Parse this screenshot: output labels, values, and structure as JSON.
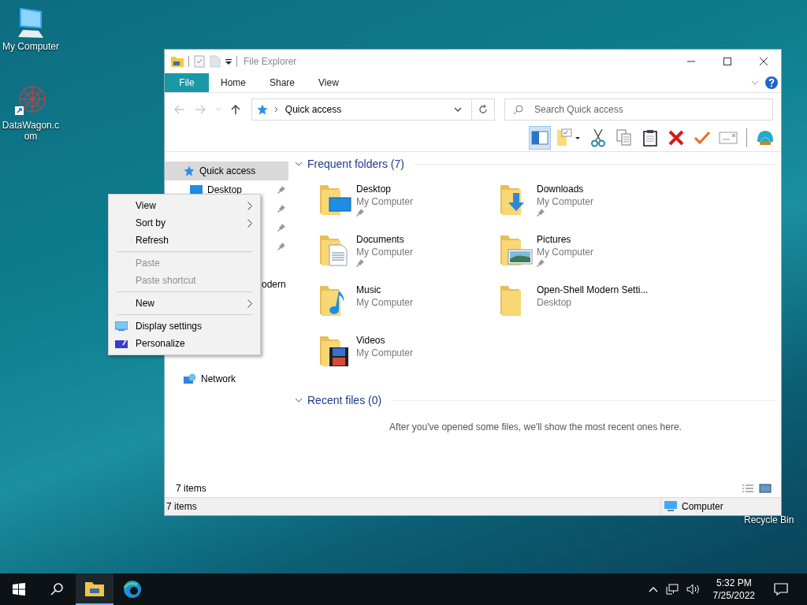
{
  "desktop_icons": [
    {
      "kind": "computer",
      "label": "My Computer"
    },
    {
      "kind": "web",
      "label": "DataWagon.com"
    }
  ],
  "recycle_bin": {
    "label": "Recycle Bin"
  },
  "window": {
    "title": "File Explorer",
    "ribbon_tabs": [
      {
        "label": "File",
        "kind": "file"
      },
      {
        "label": "Home",
        "kind": "tab"
      },
      {
        "label": "Share",
        "kind": "tab"
      },
      {
        "label": "View",
        "kind": "tab"
      }
    ],
    "address": {
      "path": "Quick access"
    },
    "search": {
      "placeholder": "Search Quick access"
    },
    "toolbar": [
      {
        "kind": "pane",
        "pressed": true
      },
      {
        "kind": "properties",
        "pressed": false
      },
      {
        "kind": "cut",
        "pressed": false
      },
      {
        "kind": "copy",
        "pressed": false
      },
      {
        "kind": "paste",
        "pressed": false
      },
      {
        "kind": "delete",
        "pressed": false
      },
      {
        "kind": "check",
        "pressed": false
      },
      {
        "kind": "mail",
        "pressed": false
      },
      {
        "kind": "shell",
        "pressed": false
      }
    ],
    "nav": [
      {
        "kind": "star",
        "label": "Quick access",
        "selected": true,
        "pinned": false
      },
      {
        "kind": "desktop",
        "label": "Desktop",
        "selected": false,
        "pinned": true
      },
      {
        "kind": "hidden",
        "selected": false,
        "pinned": true
      },
      {
        "kind": "hidden",
        "selected": false,
        "pinned": true
      },
      {
        "kind": "hidden",
        "selected": false,
        "pinned": true
      },
      {
        "kind": "hidden",
        "selected": false,
        "pinned": false
      },
      {
        "kind": "cut",
        "label": "odern",
        "selected": false,
        "pinned": false
      },
      {
        "kind": "network",
        "label": "Network",
        "selected": false,
        "pinned": false
      }
    ],
    "sections": [
      {
        "title": "Frequent folders (7)",
        "expanded": true,
        "folders": [
          {
            "name": "Desktop",
            "location": "My Computer",
            "pinned": true,
            "kind": "desktop"
          },
          {
            "name": "Downloads",
            "location": "My Computer",
            "pinned": true,
            "kind": "downloads"
          },
          {
            "name": "Documents",
            "location": "My Computer",
            "pinned": true,
            "kind": "documents"
          },
          {
            "name": "Pictures",
            "location": "My Computer",
            "pinned": true,
            "kind": "pictures"
          },
          {
            "name": "Music",
            "location": "My Computer",
            "pinned": false,
            "kind": "music"
          },
          {
            "name": "Open-Shell Modern Setti...",
            "location": "Desktop",
            "pinned": false,
            "kind": "plain"
          },
          {
            "name": "Videos",
            "location": "My Computer",
            "pinned": false,
            "kind": "videos"
          }
        ]
      },
      {
        "title": "Recent files (0)",
        "expanded": true,
        "empty_text": "After you've opened some files, we'll show the most recent ones here."
      }
    ],
    "inner_status": "7 items",
    "status_bar": {
      "items": "7 items",
      "location": "Computer"
    }
  },
  "context_menu": [
    {
      "kind": "item",
      "label": "View",
      "disabled": false,
      "submenu": true
    },
    {
      "kind": "item",
      "label": "Sort by",
      "disabled": false,
      "submenu": true
    },
    {
      "kind": "item",
      "label": "Refresh",
      "disabled": false,
      "submenu": false
    },
    {
      "kind": "separator"
    },
    {
      "kind": "item",
      "label": "Paste",
      "disabled": true,
      "submenu": false
    },
    {
      "kind": "item",
      "label": "Paste shortcut",
      "disabled": true,
      "submenu": false
    },
    {
      "kind": "separator"
    },
    {
      "kind": "item",
      "label": "New",
      "disabled": false,
      "submenu": true
    },
    {
      "kind": "separator"
    },
    {
      "kind": "display",
      "label": "Display settings",
      "disabled": false,
      "submenu": false
    },
    {
      "kind": "personalize",
      "label": "Personalize",
      "disabled": false,
      "submenu": false
    }
  ],
  "taskbar": {
    "apps": [
      {
        "kind": "explorer",
        "running": true
      },
      {
        "kind": "edge",
        "running": false
      }
    ],
    "time": "5:32 PM",
    "date": "7/25/2022"
  }
}
